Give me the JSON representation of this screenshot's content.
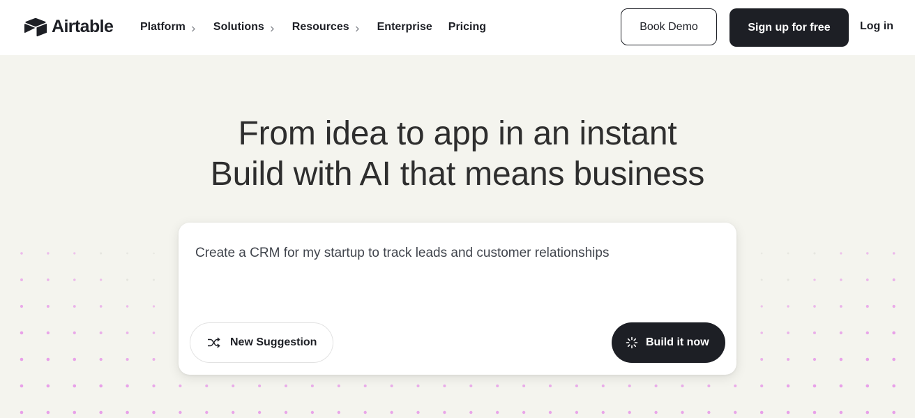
{
  "brand": {
    "name": "Airtable",
    "logo_icon": "airtable-logo-icon"
  },
  "nav": {
    "items": [
      {
        "label": "Platform",
        "has_dropdown": true
      },
      {
        "label": "Solutions",
        "has_dropdown": true
      },
      {
        "label": "Resources",
        "has_dropdown": true
      },
      {
        "label": "Enterprise",
        "has_dropdown": false
      },
      {
        "label": "Pricing",
        "has_dropdown": false
      }
    ],
    "book_demo": "Book Demo",
    "sign_up": "Sign up for free",
    "log_in": "Log in"
  },
  "hero": {
    "line1": "From idea to app in an instant",
    "line2": "Build with AI that means business"
  },
  "prompt": {
    "text": "Create a CRM for my startup to track leads and customer relationships",
    "new_suggestion": "New Suggestion",
    "new_suggestion_icon": "shuffle-icon",
    "build": "Build it now",
    "build_icon": "spinner-icon"
  },
  "colors": {
    "page_bg": "#f4f4ee",
    "dark": "#1d1f25",
    "dot_gray": "#d8d8d2",
    "dot_pink": "#e79be8"
  }
}
